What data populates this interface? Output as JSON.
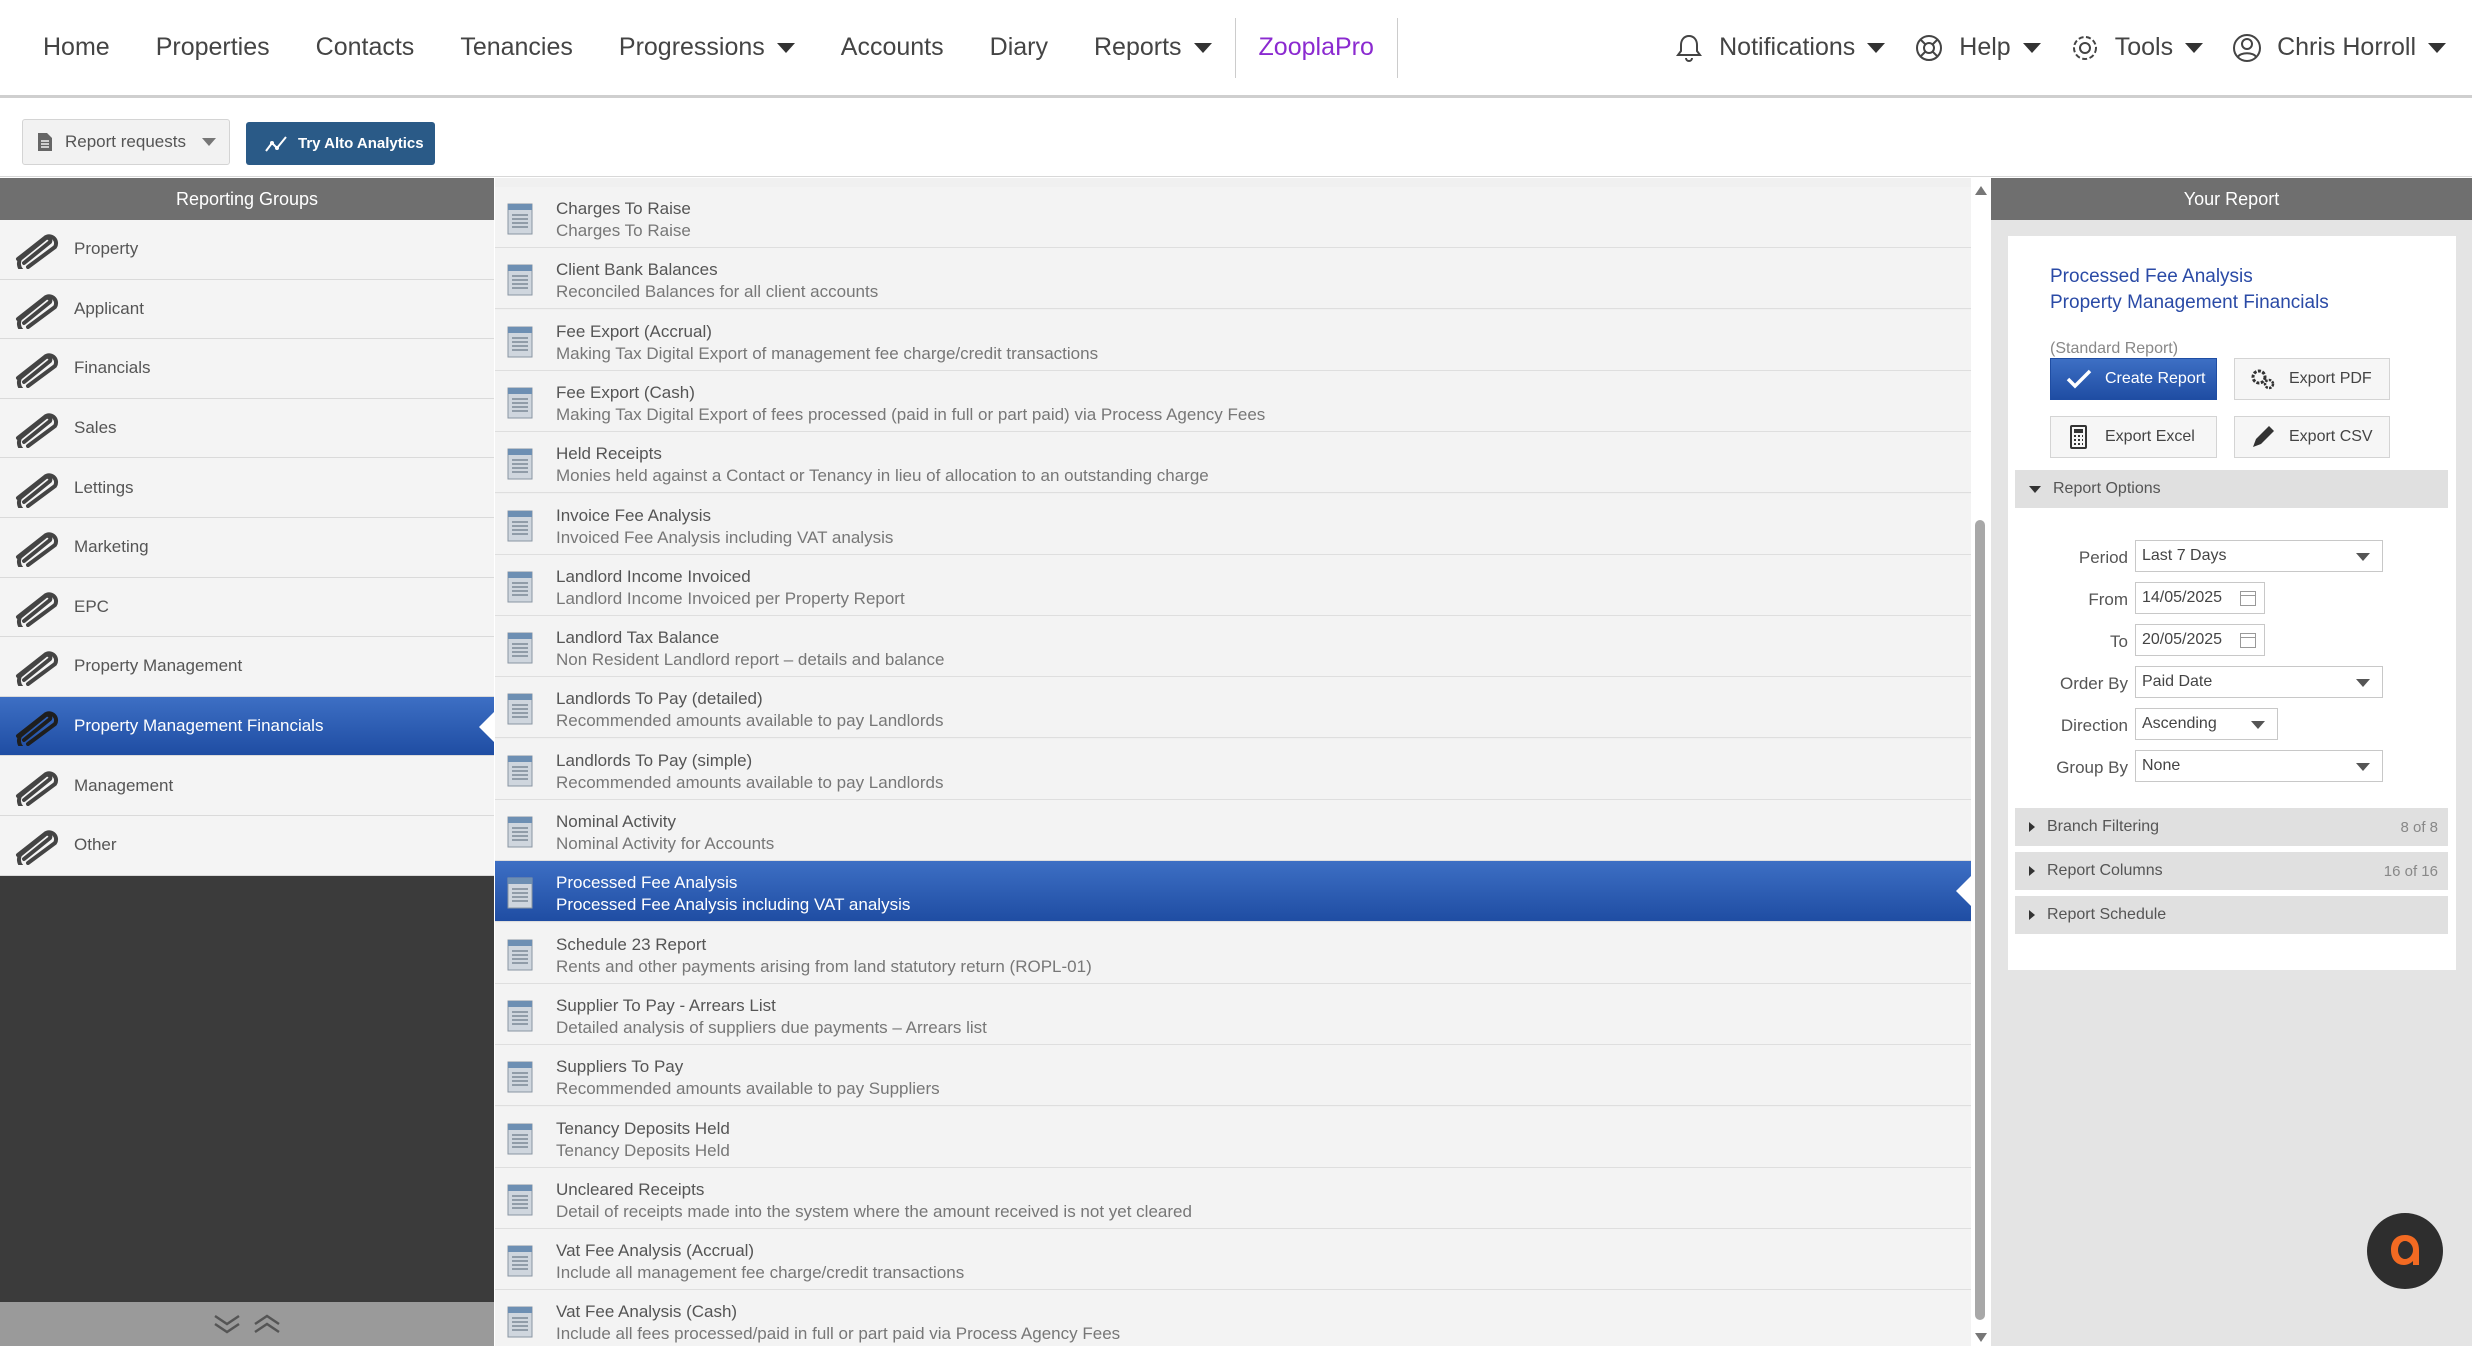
{
  "nav": {
    "items": [
      {
        "label": "Home",
        "name": "nav-home",
        "caret": false
      },
      {
        "label": "Properties",
        "name": "nav-properties",
        "caret": false
      },
      {
        "label": "Contacts",
        "name": "nav-contacts",
        "caret": false
      },
      {
        "label": "Tenancies",
        "name": "nav-tenancies",
        "caret": false
      },
      {
        "label": "Progressions",
        "name": "nav-progressions",
        "caret": true
      },
      {
        "label": "Accounts",
        "name": "nav-accounts",
        "caret": false
      },
      {
        "label": "Diary",
        "name": "nav-diary",
        "caret": false
      },
      {
        "label": "Reports",
        "name": "nav-reports",
        "caret": true
      }
    ],
    "zoopla": "ZooplaPro",
    "notifications": "Notifications",
    "help": "Help",
    "tools": "Tools",
    "user": "Chris Horroll",
    "zoopla_color": "#8b2ad0"
  },
  "toolbar": {
    "report_requests": "Report requests",
    "try_alto": "Try Alto Analytics"
  },
  "reporting_groups": {
    "header": "Reporting Groups",
    "items": [
      "Property",
      "Applicant",
      "Financials",
      "Sales",
      "Lettings",
      "Marketing",
      "EPC",
      "Property Management",
      "Property Management Financials",
      "Management",
      "Other"
    ],
    "active_index": 8
  },
  "reports": {
    "items": [
      {
        "title": "Charges To Raise",
        "desc": "Charges To Raise"
      },
      {
        "title": "Client Bank Balances",
        "desc": "Reconciled Balances for all client accounts"
      },
      {
        "title": "Fee Export (Accrual)",
        "desc": "Making Tax Digital Export of management fee charge/credit transactions"
      },
      {
        "title": "Fee Export (Cash)",
        "desc": "Making Tax Digital Export of fees processed (paid in full or part paid) via Process Agency Fees"
      },
      {
        "title": "Held Receipts",
        "desc": "Monies held against a Contact or Tenancy in lieu of allocation to an outstanding charge"
      },
      {
        "title": "Invoice Fee Analysis",
        "desc": "Invoiced Fee Analysis including VAT analysis"
      },
      {
        "title": "Landlord Income Invoiced",
        "desc": "Landlord Income Invoiced per Property Report"
      },
      {
        "title": "Landlord Tax Balance",
        "desc": "Non Resident Landlord report – details and balance"
      },
      {
        "title": "Landlords To Pay (detailed)",
        "desc": "Recommended amounts available to pay Landlords"
      },
      {
        "title": "Landlords To Pay (simple)",
        "desc": "Recommended amounts available to pay Landlords"
      },
      {
        "title": "Nominal Activity",
        "desc": "Nominal Activity for Accounts"
      },
      {
        "title": "Processed Fee Analysis",
        "desc": "Processed Fee Analysis including VAT analysis"
      },
      {
        "title": "Schedule 23 Report",
        "desc": "Rents and other payments arising from land statutory return (ROPL-01)"
      },
      {
        "title": "Supplier To Pay - Arrears List",
        "desc": "Detailed analysis of suppliers due payments – Arrears list"
      },
      {
        "title": "Suppliers To Pay",
        "desc": "Recommended amounts available to pay Suppliers"
      },
      {
        "title": "Tenancy Deposits Held",
        "desc": "Tenancy Deposits Held"
      },
      {
        "title": "Uncleared Receipts",
        "desc": "Detail of receipts made into the system where the amount received is not yet cleared"
      },
      {
        "title": "Vat Fee Analysis (Accrual)",
        "desc": "Include all management fee charge/credit transactions"
      },
      {
        "title": "Vat Fee Analysis (Cash)",
        "desc": "Include all fees processed/paid in full or part paid via Process Agency Fees"
      }
    ],
    "active_index": 11
  },
  "your_report": {
    "header": "Your Report",
    "title": "Processed Fee Analysis",
    "group": "Property Management Financials",
    "type": "(Standard Report)",
    "create_report": "Create Report",
    "export_pdf": "Export PDF",
    "export_excel": "Export Excel",
    "export_csv": "Export CSV",
    "report_options": "Report Options",
    "period_label": "Period",
    "period_value": "Last 7 Days",
    "from_label": "From",
    "from_value": "14/05/2025",
    "to_label": "To",
    "to_value": "20/05/2025",
    "order_by_label": "Order By",
    "order_by_value": "Paid Date",
    "direction_label": "Direction",
    "direction_value": "Ascending",
    "group_by_label": "Group By",
    "group_by_value": "None",
    "branch_filtering": "Branch Filtering",
    "branch_count": "8 of 8",
    "report_columns": "Report Columns",
    "columns_count": "16 of 16",
    "report_schedule": "Report Schedule"
  },
  "colors": {
    "active_blue": "#2a55b0",
    "alto_orange": "#f26a22"
  }
}
